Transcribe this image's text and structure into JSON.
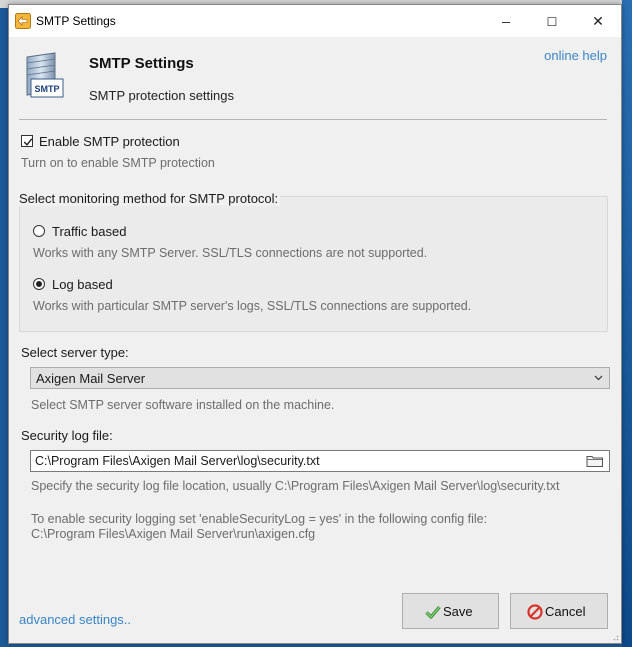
{
  "window": {
    "title": "SMTP Settings",
    "minimize_glyph": "–",
    "maximize_glyph": "☐",
    "close_glyph": "✕"
  },
  "header": {
    "title": "SMTP Settings",
    "subtitle": "SMTP protection settings",
    "help_link": "online help",
    "icon_badge": "SMTP",
    "icon": "smtp-server-icon"
  },
  "protection": {
    "checkbox_label": "Enable SMTP protection",
    "checked": true,
    "hint": "Turn on to enable SMTP protection"
  },
  "monitoring": {
    "group_title": "Select monitoring method for SMTP protocol:",
    "options": [
      {
        "label": "Traffic based",
        "hint": "Works with any SMTP Server. SSL/TLS connections are not supported.",
        "selected": false
      },
      {
        "label": "Log based",
        "hint": "Works with particular SMTP server's logs, SSL/TLS connections are supported.",
        "selected": true
      }
    ]
  },
  "server_type": {
    "label": "Select server type:",
    "selected": "Axigen Mail Server",
    "hint": "Select SMTP server software installed on the machine."
  },
  "security_log": {
    "label": "Security log file:",
    "value": "C:\\Program Files\\Axigen Mail Server\\log\\security.txt",
    "hint": "Specify the security log file location, usually C:\\Program Files\\Axigen Mail Server\\log\\security.txt",
    "note_line1": "To enable security logging set 'enableSecurityLog = yes' in the following config file:",
    "note_line2": "C:\\Program Files\\Axigen Mail Server\\run\\axigen.cfg"
  },
  "footer": {
    "advanced_link": "advanced settings..",
    "save_label": "Save",
    "cancel_label": "Cancel"
  },
  "colors": {
    "link": "#3a86c8",
    "hint_text": "#6d6d6d",
    "save_check": "#4caf50",
    "cancel_icon": "#d9342b"
  }
}
